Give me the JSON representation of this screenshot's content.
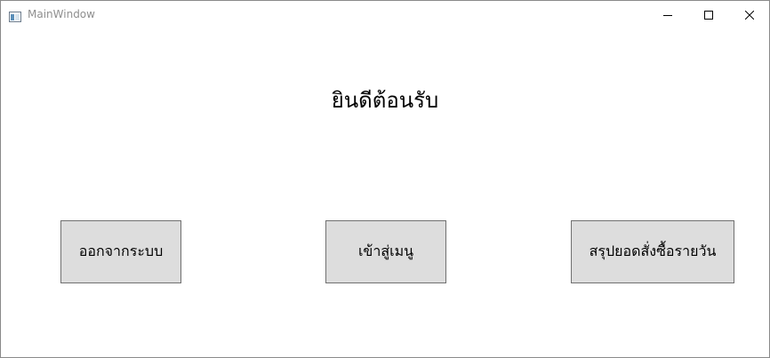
{
  "window": {
    "title": "MainWindow",
    "icons": {
      "app": "app-window-icon",
      "minimize": "minimize-icon",
      "maximize": "maximize-icon",
      "close": "close-icon"
    }
  },
  "main": {
    "welcome_text": "ยินดีต้อนรับ",
    "buttons": {
      "logout_label": "ออกจากระบบ",
      "menu_label": "เข้าสู่เมนู",
      "daily_summary_label": "สรุปยอดสั่งซื้อรายวัน"
    }
  },
  "colors": {
    "button_background": "#dddddd",
    "button_border": "#707070",
    "title_text": "#8f8f8f"
  }
}
